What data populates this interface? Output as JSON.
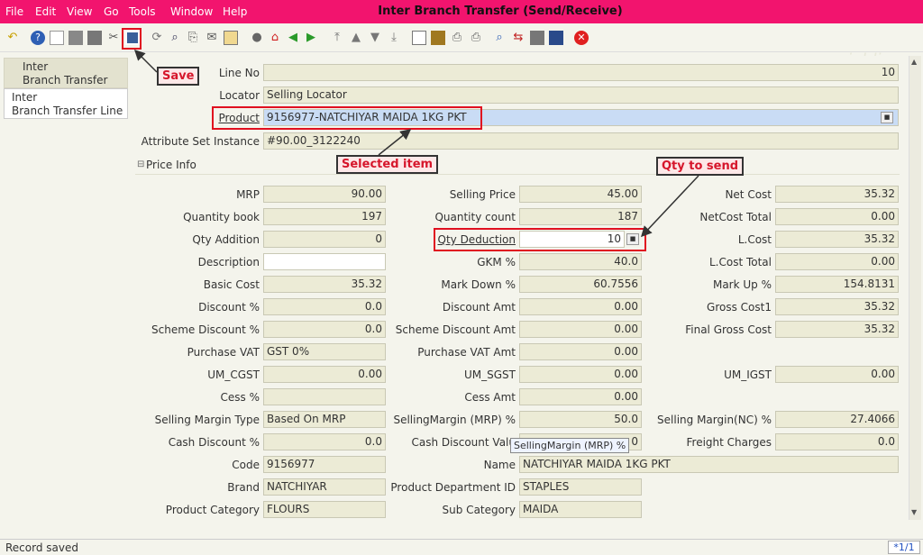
{
  "menu": {
    "items": [
      "File",
      "Edit",
      "View",
      "Go",
      "Tools",
      "Window",
      "Help"
    ],
    "title": "Inter Branch Transfer (Send/Receive)"
  },
  "watermark": "jaldi",
  "sidebar": {
    "tab1": "Inter\nBranch Transfer",
    "tab2": "Inter\nBranch Transfer Line"
  },
  "form": {
    "line_no_label": "Line No",
    "line_no": "10",
    "locator_label": "Locator",
    "locator": "Selling Locator",
    "product_label": "Product",
    "product": "9156977-NATCHIYAR MAIDA 1KG PKT",
    "asi_label": "Attribute Set Instance",
    "asi": "#90.00_3122240",
    "section": "Price Info",
    "mrp_label": "MRP",
    "mrp": "90.00",
    "selling_price_label": "Selling Price",
    "selling_price": "45.00",
    "net_cost_label": "Net Cost",
    "net_cost": "35.32",
    "qty_book_label": "Quantity book",
    "qty_book": "197",
    "qty_count_label": "Quantity count",
    "qty_count": "187",
    "netcost_total_label": "NetCost Total",
    "netcost_total": "0.00",
    "qty_add_label": "Qty Addition",
    "qty_add": "0",
    "qty_ded_label": "Qty Deduction",
    "qty_ded": "10",
    "lcost_label": "L.Cost",
    "lcost": "35.32",
    "desc_label": "Description",
    "desc": "",
    "gkm_label": "GKM %",
    "gkm": "40.0",
    "lcost_total_label": "L.Cost Total",
    "lcost_total": "0.00",
    "basic_cost_label": "Basic Cost",
    "basic_cost": "35.32",
    "markdown_label": "Mark Down %",
    "markdown": "60.7556",
    "markup_label": "Mark Up %",
    "markup": "154.8131",
    "disc_pct_label": "Discount %",
    "disc_pct": "0.0",
    "disc_amt_label": "Discount Amt",
    "disc_amt": "0.00",
    "gross_cost1_label": "Gross Cost1",
    "gross_cost1": "35.32",
    "scheme_pct_label": "Scheme Discount %",
    "scheme_pct": "0.0",
    "scheme_amt_label": "Scheme Discount Amt",
    "scheme_amt": "0.00",
    "final_gross_label": "Final Gross Cost",
    "final_gross": "35.32",
    "pvat_label": "Purchase VAT",
    "pvat": "GST 0%",
    "pvat_amt_label": "Purchase VAT Amt",
    "pvat_amt": "0.00",
    "cgst_label": "UM_CGST",
    "cgst": "0.00",
    "sgst_label": "UM_SGST",
    "sgst": "0.00",
    "igst_label": "UM_IGST",
    "igst": "0.00",
    "cess_pct_label": "Cess %",
    "cess_pct": "",
    "cess_amt_label": "Cess Amt",
    "cess_amt": "0.00",
    "smt_label": "Selling Margin Type",
    "smt": "Based On MRP",
    "sm_mrp_label": "SellingMargin (MRP) %",
    "sm_mrp": "50.0",
    "sm_nc_label": "Selling Margin(NC) %",
    "sm_nc": "27.4066",
    "cash_pct_label": "Cash Discount %",
    "cash_pct": "0.0",
    "cash_val_label": "Cash Discount Valu",
    "cash_val": "0",
    "freight_label": "Freight Charges",
    "freight": "0.0",
    "code_label": "Code",
    "code": "9156977",
    "name_label": "Name",
    "name": "NATCHIYAR MAIDA 1KG PKT",
    "brand_label": "Brand",
    "brand": "NATCHIYAR",
    "dept_label": "Product Department ID",
    "dept": "STAPLES",
    "cat_label": "Product Category",
    "cat": "FLOURS",
    "subcat_label": "Sub Category",
    "subcat": "MAIDA"
  },
  "tooltip": "SellingMargin (MRP) %",
  "callouts": {
    "save": "Save",
    "selected": "Selected item",
    "qty": "Qty to send"
  },
  "status": {
    "text": "Record saved",
    "page": "*1/1"
  },
  "colors": {
    "menubar": "#f2146e",
    "callout_text": "#d6162b",
    "highlight": "#e01020"
  }
}
